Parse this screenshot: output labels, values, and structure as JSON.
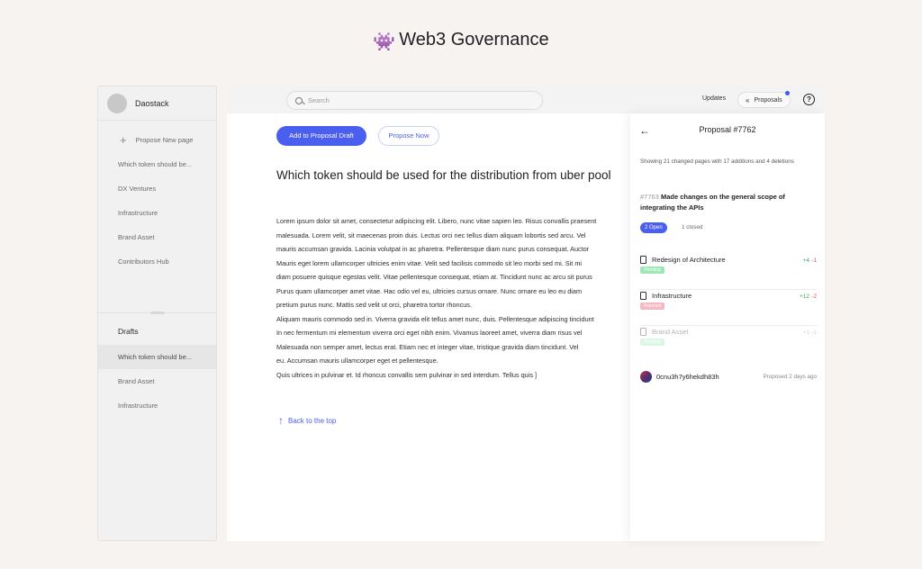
{
  "page": {
    "title": "Web3 Governance",
    "emoji": "👾"
  },
  "sidebar": {
    "workspace": "Daostack",
    "propose_label": "Propose New page",
    "items": [
      "Which token should be...",
      "DX Ventures",
      "Infrastructure",
      "Brand Asset",
      "Contributors Hub"
    ],
    "drafts_heading": "Drafts",
    "drafts": [
      "Which token should be...",
      "Brand Asset",
      "Infrastructure"
    ]
  },
  "topbar": {
    "search_placeholder": "Search",
    "updates_label": "Updates",
    "proposals_label": "Proposals",
    "help_label": "?"
  },
  "main": {
    "add_draft_label": "Add to Proposal Draft",
    "propose_now_label": "Propose Now",
    "doc_title": "Which token should be used for the distribution from uber pool",
    "body_lines": [
      "Lorem ipsum dolor sit amet, consectetur adipiscing elit. Libero, nunc vitae sapien leo. Risus convallis praesent",
      "malesuada. Lorem velit, sit maecenas proin duis. Lectus orci nec tellus diam aliquam lobortis sed arcu. Vel",
      "mauris accumsan gravida. Lacinia volutpat in ac pharetra. Pellentesque diam nunc purus consequat. Auctor",
      "Mauris eget lorem ullamcorper ultricies enim vitae. Velit sed facilisis commodo sit leo morbi sed mi. Sit mi",
      "diam posuere quisque egestas velit. Vitae pellentesque consequat, etiam at. Tincidunt nunc ac arcu sit purus",
      "Purus quam ullamcorper amet vitae. Hac odio vel eu, ultricies cursus ornare. Nunc ornare eu leo eu diam",
      "pretium purus nunc. Mattis sed velit ut orci, pharetra tortor rhoncus.",
      "Aliquam mauris commodo sed in. Viverra gravida elit tellus amet nunc, duis. Pellentesque adipiscing tincidunt",
      "In nec fermentum mi elementum viverra orci eget nibh enim. Vivamus laoreet amet, viverra diam risus vel",
      "Malesuada non semper amet, lectus erat. Etiam nec et integer vitae, tristique gravida diam tincidunt. Vel",
      "eu. Accumsan mauris ullamcorper eget et pellentesque.",
      "Quis ultrices in pulvinar et. Id rhoncus convallis sem pulvinar in sed interdum. Tellus quis ]"
    ],
    "back_to_top_label": "Back to the top"
  },
  "panel": {
    "back_icon": "←",
    "title": "Proposal #7762",
    "summary": "Showing 21 changed pages with 17 additions and 4 deletions",
    "pr_number": "#7763",
    "pr_title": "Made changes on the general scope of integrating the APIs",
    "open_label": "2 Open",
    "closed_label": "1 closed",
    "files": [
      {
        "name": "Redesign of Architecture",
        "tag": "Pending",
        "tag_color": "#9ee6b5",
        "add": "+4",
        "del": "-1"
      },
      {
        "name": "Infrastructure",
        "tag": "Rejected",
        "tag_color": "#f5b8c0",
        "add": "+12",
        "del": "-2"
      },
      {
        "name": "Brand Asset",
        "tag": "Pending",
        "tag_color": "#9ee6b5",
        "add": "+1",
        "del": "-1"
      }
    ],
    "author_address": "0cnu3h7y6hekdh83h",
    "proposed_when": "Proposed 2 days ago"
  },
  "colors": {
    "accent": "#4a5ef0",
    "background": "#f7f3f0"
  }
}
